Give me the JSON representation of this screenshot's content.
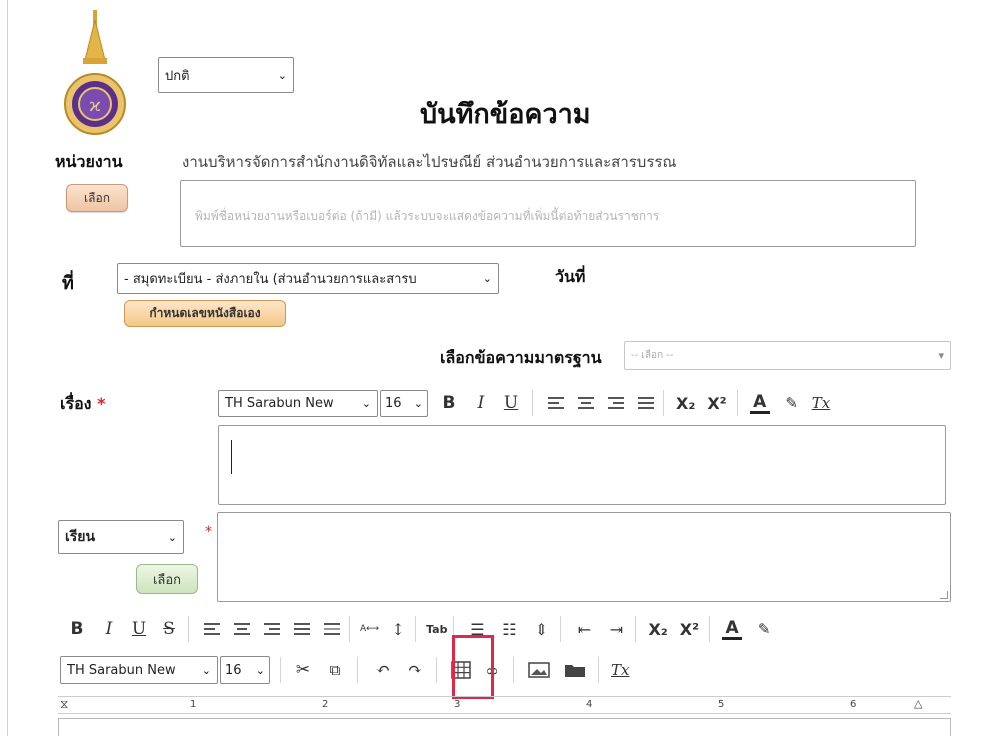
{
  "header": {
    "mode_select": "ปกติ",
    "title": "บันทึกข้อความ"
  },
  "unit": {
    "label": "หน่วยงาน",
    "value": "งานบริหารจัดการสำนักงานดิจิทัลและไปรษณีย์ ส่วนอำนวยการและสารบรรณ",
    "select_button": "เลือก",
    "textbox_placeholder": "พิมพ์ชื่อหน่วยงานหรือเบอร์ต่อ (ถ้ามี) แล้วระบบจะแสดงข้อความที่เพิ่มนี้ต่อท้ายส่วนราชการ"
  },
  "doc_no": {
    "label": "ที่",
    "select_value": "- สมุดทะเบียน - ส่งภายใน (ส่วนอำนวยการและสารบ",
    "custom_button": "กำหนดเลขหนังสือเอง",
    "date_label": "วันที่"
  },
  "standard": {
    "label": "เลือกข้อความมาตรฐาน",
    "select_value": "-- เลือก --"
  },
  "subject": {
    "label": "เรื่อง",
    "required_mark": "*",
    "font_name": "TH Sarabun New",
    "font_size": "16",
    "toolbar": {
      "bold": "B",
      "italic": "I",
      "underline": "U",
      "sub": "X₂",
      "sup": "X²",
      "font_color": "A",
      "clear": "Tx"
    }
  },
  "salutation": {
    "select_value": "เรียน",
    "required_mark": "*",
    "select_button": "เลือก"
  },
  "body_editor": {
    "row1": {
      "bold": "B",
      "italic": "I",
      "underline": "U",
      "strike": "S",
      "sub": "X₂",
      "sup": "X²",
      "font_color": "A",
      "tab": "Tab",
      "spacing": "A⟷"
    },
    "font_name": "TH Sarabun New",
    "font_size": "16",
    "clear": "Tx",
    "ruler_numbers": [
      "1",
      "2",
      "3",
      "4",
      "5",
      "6"
    ]
  },
  "colors": {
    "highlight": "#e0294a",
    "required": "#d9242b",
    "logo_purple": "#5b2f8a",
    "logo_gold": "#d8a437"
  }
}
